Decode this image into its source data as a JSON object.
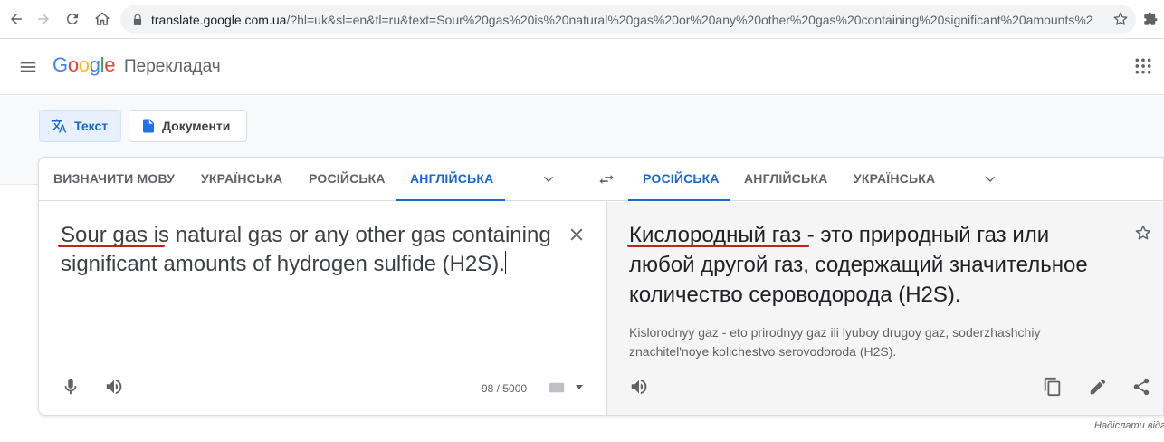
{
  "browser": {
    "url_domain": "translate.google.com.ua",
    "url_rest": "/?hl=uk&sl=en&tl=ru&text=Sour%20gas%20is%20natural%20gas%20or%20any%20other%20gas%20containing%20significant%20amounts%2..."
  },
  "header": {
    "logo_letters": [
      "G",
      "o",
      "o",
      "g",
      "l",
      "e"
    ],
    "logo_colors": [
      "#4285f4",
      "#ea4335",
      "#fbbc05",
      "#4285f4",
      "#34a853",
      "#ea4335"
    ],
    "product_name": "Перекладач"
  },
  "modes": {
    "text_label": "Текст",
    "documents_label": "Документи"
  },
  "source_langs": [
    "ВИЗНАЧИТИ МОВУ",
    "УКРАЇНСЬКА",
    "РОСІЙСЬКА",
    "АНГЛІЙСЬКА"
  ],
  "target_langs": [
    "РОСІЙСЬКА",
    "АНГЛІЙСЬКА",
    "УКРАЇНСЬКА"
  ],
  "source": {
    "text": "Sour gas is natural gas or any other gas containing significant amounts of hydrogen sulfide (H2S).",
    "char_count": "98 / 5000"
  },
  "result": {
    "text": "Кислородный газ - это природный газ или любой другой газ, содержащий значительное количество сероводорода (H2S).",
    "transliteration": "Kislorodnyy gaz - eto prirodnyy gaz ili lyuboy drugoy gaz, soderzhashchiy znachitel'noye kolichestvo serovodoroda (H2S)."
  },
  "footer": {
    "send_feedback": "Надіслати відгук"
  },
  "colors": {
    "accent": "#1967d2",
    "squiggle": "#c5221f"
  }
}
